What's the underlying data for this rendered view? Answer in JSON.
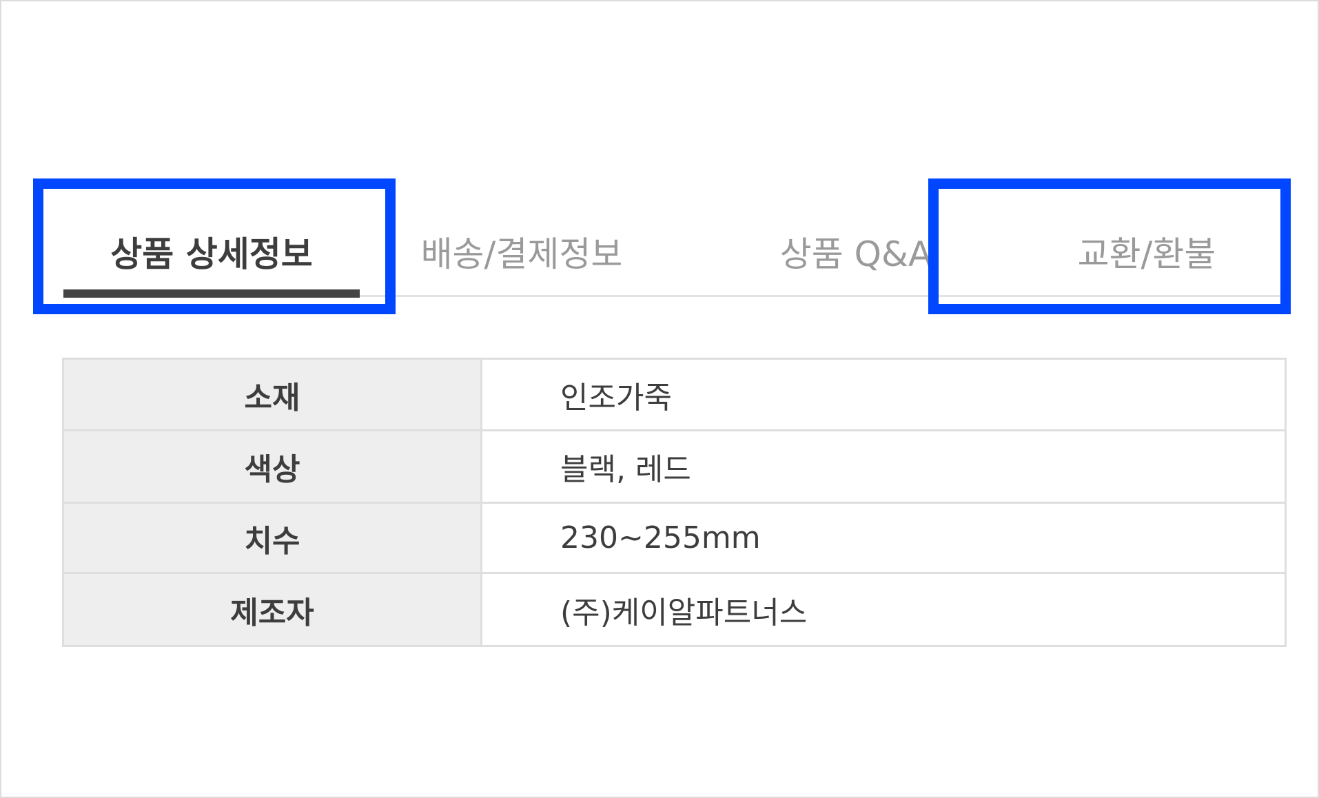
{
  "tabs": [
    {
      "label": "상품 상세정보",
      "active": true
    },
    {
      "label": "배송/결제정보",
      "active": false
    },
    {
      "label": "상품 Q&A",
      "active": false
    },
    {
      "label": "교환/환불",
      "active": false
    }
  ],
  "spec_table": {
    "rows": [
      {
        "label": "소재",
        "value": "인조가죽"
      },
      {
        "label": "색상",
        "value": "블랙, 레드"
      },
      {
        "label": "치수",
        "value": "230~255mm"
      },
      {
        "label": "제조자",
        "value": "(주)케이알파트너스"
      }
    ]
  },
  "colors": {
    "highlight": "#0047ff",
    "active_tab_text": "#3d3d3d",
    "inactive_tab_text": "#9a9a9a",
    "label_cell_bg": "#eeeeee",
    "border": "#dedede"
  }
}
